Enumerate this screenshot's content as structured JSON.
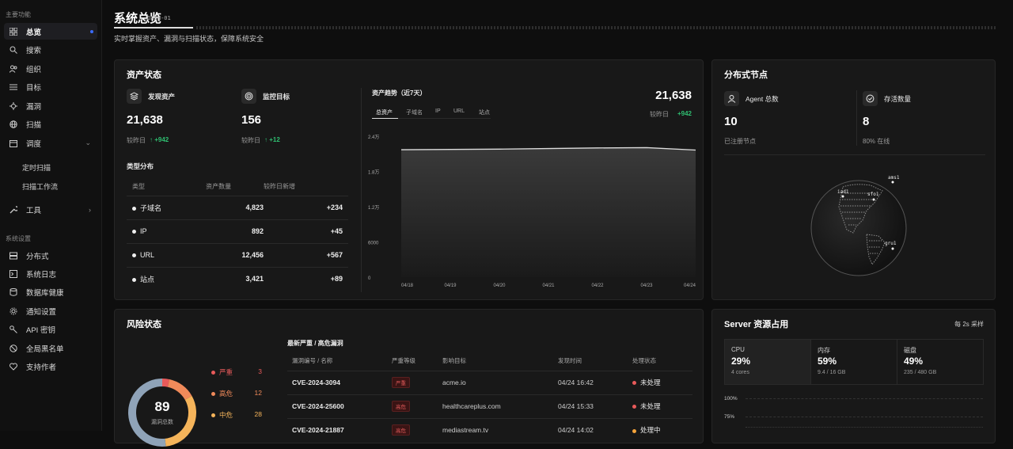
{
  "sidebar": {
    "group_main": "主要功能",
    "group_sys": "系统设置",
    "items": [
      {
        "label": "总览"
      },
      {
        "label": "搜索"
      },
      {
        "label": "组织"
      },
      {
        "label": "目标"
      },
      {
        "label": "漏洞"
      },
      {
        "label": "扫描"
      },
      {
        "label": "调度"
      },
      {
        "label": "定时扫描"
      },
      {
        "label": "扫描工作流"
      },
      {
        "label": "工具"
      }
    ],
    "sys_items": [
      {
        "label": "分布式"
      },
      {
        "label": "系统日志"
      },
      {
        "label": "数据库健康"
      },
      {
        "label": "通知设置"
      },
      {
        "label": "API 密钥"
      },
      {
        "label": "全局黑名单"
      },
      {
        "label": "支持作者"
      }
    ]
  },
  "header": {
    "title": "系统总览",
    "code": "/DASH-01",
    "subtitle": "实时掌握资产、漏洞与扫描状态，保障系统安全"
  },
  "assets": {
    "title": "资产状态",
    "found_label": "发现资产",
    "found_value": "21,638",
    "found_delta_label": "较昨日",
    "found_delta": "↑ +942",
    "monitor_label": "监控目标",
    "monitor_value": "156",
    "monitor_delta_label": "较昨日",
    "monitor_delta": "↑ +12",
    "type_title": "类型分布",
    "col_type": "类型",
    "col_count": "资产数量",
    "col_new": "较昨日新增",
    "rows": [
      {
        "name": "子域名",
        "count": "4,823",
        "new": "+234"
      },
      {
        "name": "IP",
        "count": "892",
        "new": "+45"
      },
      {
        "name": "URL",
        "count": "12,456",
        "new": "+567"
      },
      {
        "name": "站点",
        "count": "3,421",
        "new": "+89"
      }
    ]
  },
  "trend": {
    "title": "资产趋势（近7天）",
    "total": "21,638",
    "delta_label": "较昨日",
    "delta": "+942",
    "tabs": [
      "总资产",
      "子域名",
      "IP",
      "URL",
      "站点"
    ]
  },
  "chart_data": {
    "type": "area",
    "x": [
      "04/18",
      "04/19",
      "04/20",
      "04/21",
      "04/22",
      "04/23",
      "04/24"
    ],
    "series": [
      {
        "values": [
          21700,
          21750,
          21800,
          21900,
          22000,
          22050,
          21638
        ]
      }
    ],
    "yticks": [
      "2.4万",
      "1.8万",
      "1.2万",
      "6000",
      "0"
    ],
    "ylim": [
      0,
      24000
    ],
    "title": "",
    "xlabel": "",
    "ylabel": ""
  },
  "nodes": {
    "title": "分布式节点",
    "agent_label": "Agent 总数",
    "agent_value": "10",
    "agent_sub": "已注册节点",
    "alive_label": "存活数量",
    "alive_value": "8",
    "alive_sub": "80% 在线",
    "globe_labels": [
      "ams1",
      "iad1",
      "sfo1",
      "gru1"
    ]
  },
  "risk": {
    "title": "风险状态",
    "total": "89",
    "total_label": "漏洞总数",
    "legend": [
      {
        "name": "严重",
        "count": "3",
        "color": "#e85a5a"
      },
      {
        "name": "高危",
        "count": "12",
        "color": "#f08a5a"
      },
      {
        "name": "中危",
        "count": "28",
        "color": "#f5b45a"
      }
    ],
    "vuln_title": "最新严重 / 高危漏洞",
    "cols": [
      "漏洞编号 / 名称",
      "严重等级",
      "影响目标",
      "发现时间",
      "处理状态"
    ],
    "vulns": [
      {
        "id": "CVE-2024-3094",
        "level": "严重",
        "target": "acme.io",
        "time": "04/24 16:42",
        "status": "未处理",
        "sc": "#e85a5a"
      },
      {
        "id": "CVE-2024-25600",
        "level": "高危",
        "target": "healthcareplus.com",
        "time": "04/24 15:33",
        "status": "未处理",
        "sc": "#e85a5a"
      },
      {
        "id": "CVE-2024-21887",
        "level": "高危",
        "target": "mediastream.tv",
        "time": "04/24 14:02",
        "status": "处理中",
        "sc": "#f5a33a"
      }
    ]
  },
  "server": {
    "title": "Server 资源占用",
    "refresh": "每 2s 采样",
    "cpu_label": "CPU",
    "cpu_value": "29%",
    "cpu_sub": "4 cores",
    "mem_label": "内存",
    "mem_value": "59%",
    "mem_sub": "9.4 / 16 GB",
    "disk_label": "磁盘",
    "disk_value": "49%",
    "disk_sub": "235 / 480 GB",
    "yticks": [
      "100%",
      "75%"
    ]
  }
}
